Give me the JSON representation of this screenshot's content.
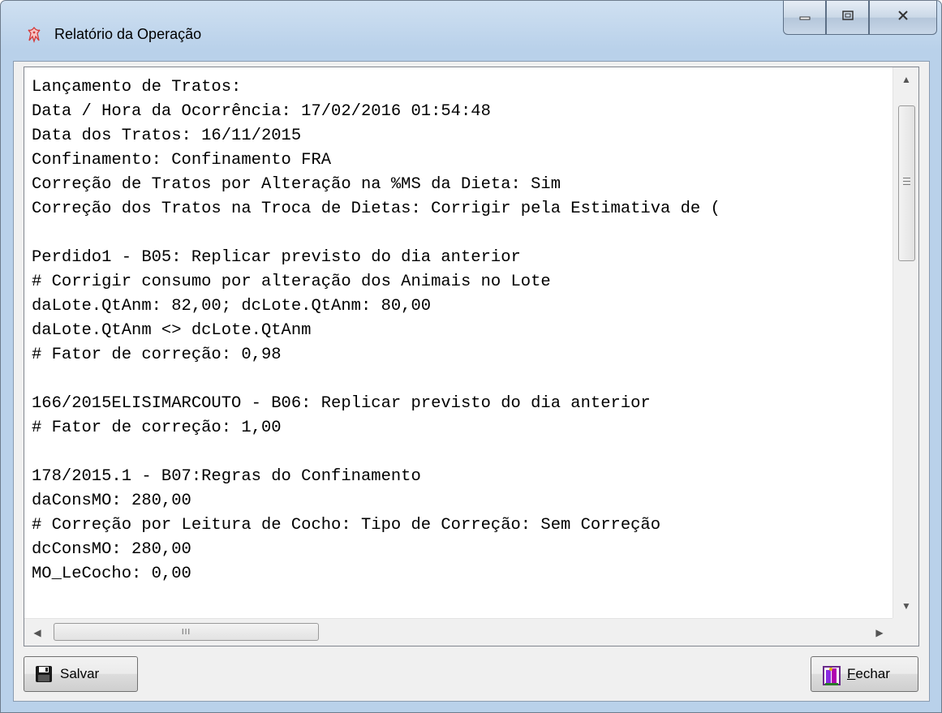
{
  "window": {
    "title": "Relatório da Operação"
  },
  "caption_buttons": {
    "minimize": "minimize",
    "restore": "restore",
    "close": "close"
  },
  "report": {
    "lines": [
      "Lançamento de Tratos:",
      "Data / Hora da Ocorrência: 17/02/2016 01:54:48",
      "Data dos Tratos: 16/11/2015",
      "Confinamento: Confinamento FRA",
      "Correção de Tratos por Alteração na %MS da Dieta: Sim",
      "Correção dos Tratos na Troca de Dietas: Corrigir pela Estimativa de (",
      "",
      "Perdido1 - B05: Replicar previsto do dia anterior",
      "# Corrigir consumo por alteração dos Animais no Lote",
      "daLote.QtAnm: 82,00; dcLote.QtAnm: 80,00",
      "daLote.QtAnm <> dcLote.QtAnm",
      "# Fator de correção: 0,98",
      "",
      "166/2015ELISIMARCOUTO - B06: Replicar previsto do dia anterior",
      "# Fator de correção: 1,00",
      "",
      "178/2015.1 - B07:Regras do Confinamento",
      "daConsMO: 280,00",
      "# Correção por Leitura de Cocho: Tipo de Correção: Sem Correção",
      "dcConsMO: 280,00",
      "MO_LeCocho: 0,00"
    ]
  },
  "hscroll": {
    "thumb_glyph": "III"
  },
  "buttons": {
    "save": "Salvar",
    "close": "Fechar"
  },
  "icons": {
    "app": "app-icon",
    "save": "floppy-disk-icon",
    "close": "door-exit-icon"
  }
}
